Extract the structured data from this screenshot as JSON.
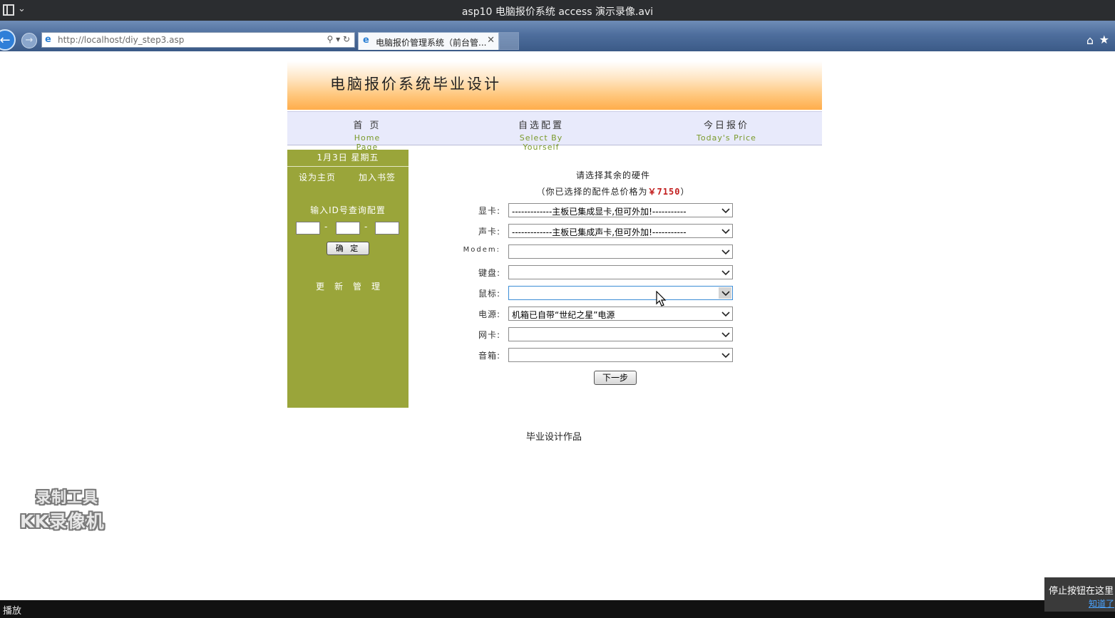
{
  "player": {
    "title": "asp10 电脑报价系统 access 演示录像.avi",
    "status_label": "播放",
    "tip_text": "停止按钮在这里",
    "tip_link": "知道了"
  },
  "browser": {
    "url": "http://localhost/diy_step3.asp",
    "tab_title": "电脑报价管理系统（前台管..."
  },
  "page": {
    "site_title": "电脑报价系统毕业设计",
    "nav": [
      {
        "zh": "首 页",
        "en": "Home Page"
      },
      {
        "zh": "自选配置",
        "en": "Select By Yourself"
      },
      {
        "zh": "今日报价",
        "en": "Today's Price"
      }
    ],
    "sidebar": {
      "date": "1月3日 星期五",
      "set_home": "设为主页",
      "add_bookmark": "加入书签",
      "query_label": "输入ID号查询配置",
      "dash": "-",
      "ok_button": "确 定",
      "manage": "更新管理"
    },
    "heading": "请选择其余的硬件",
    "subheading_prefix": "（你已选择的配件总价格为",
    "total_price": "￥7150",
    "subheading_suffix": "）",
    "fields": [
      {
        "label": "显卡:",
        "value": "-------------主板已集成显卡,但可外加!-----------"
      },
      {
        "label": "声卡:",
        "value": "-------------主板已集成声卡,但可外加!-----------"
      },
      {
        "label": "Modem:",
        "value": ""
      },
      {
        "label": "键盘:",
        "value": ""
      },
      {
        "label": "鼠标:",
        "value": ""
      },
      {
        "label": "电源:",
        "value": "机箱已自带“世纪之星”电源"
      },
      {
        "label": "网卡:",
        "value": ""
      },
      {
        "label": "音箱:",
        "value": ""
      }
    ],
    "next_button": "下一步",
    "footer": "毕业设计作品"
  },
  "watermark": {
    "line1": "录制工具",
    "line2": "KK录像机"
  },
  "colors": {
    "sidebar_bg": "#9aa53a",
    "nav_bg": "#e8eafb",
    "price": "#c21d1d",
    "banner_orange": "#ffad4b"
  },
  "icons": [
    "menu-icon",
    "chevron-down-icon",
    "back-arrow-icon",
    "forward-arrow-icon",
    "ie-logo-icon",
    "search-icon",
    "refresh-icon",
    "close-icon",
    "home-icon",
    "favorites-star-icon",
    "mouse-cursor-icon"
  ]
}
